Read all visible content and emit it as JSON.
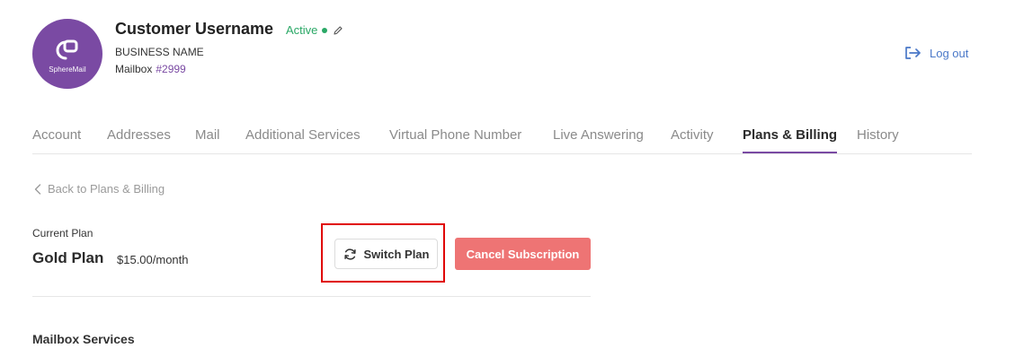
{
  "customer": {
    "avatar_brand": "SphereMail",
    "username": "Customer Username",
    "status": "Active",
    "status_color": "#2aa866",
    "business_name": "BUSINESS NAME",
    "mailbox_label": "Mailbox",
    "mailbox_number": "#2999"
  },
  "header": {
    "logout_label": "Log out",
    "logout_icon": "logout-icon"
  },
  "tabs": [
    {
      "label": "Account",
      "active": false
    },
    {
      "label": "Addresses",
      "active": false
    },
    {
      "label": "Mail",
      "active": false
    },
    {
      "label": "Additional Services",
      "active": false
    },
    {
      "label": "Virtual Phone Number",
      "active": false
    },
    {
      "label": "Live Answering",
      "active": false
    },
    {
      "label": "Activity",
      "active": false
    },
    {
      "label": "Plans & Billing",
      "active": true
    },
    {
      "label": "History",
      "active": false
    }
  ],
  "back_link": {
    "label": "Back to Plans & Billing",
    "icon": "chevron-left-icon"
  },
  "current_plan": {
    "label": "Current Plan",
    "name": "Gold Plan",
    "price": "$15.00/month"
  },
  "actions": {
    "switch_label": "Switch Plan",
    "switch_icon": "refresh-icon",
    "cancel_label": "Cancel Subscription",
    "cancel_color": "#ee7474"
  },
  "section": {
    "mailbox_services_title": "Mailbox Services"
  },
  "colors": {
    "brand": "#7a4aa3",
    "link": "#4a78c8",
    "highlight": "#e00000"
  }
}
